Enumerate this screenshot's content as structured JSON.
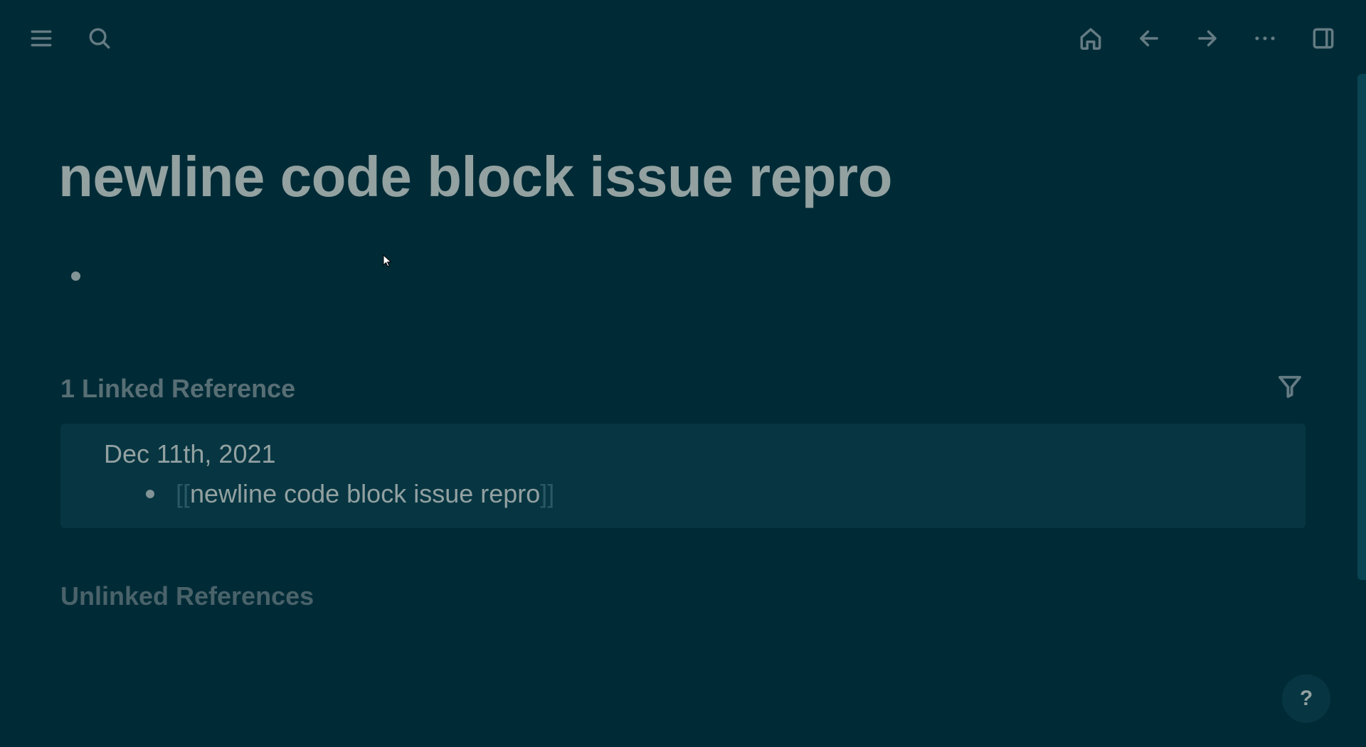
{
  "header": {
    "left_icons": [
      "menu-icon",
      "search-icon"
    ],
    "right_icons": [
      "home-icon",
      "arrow-left-icon",
      "arrow-right-icon",
      "more-icon",
      "sidebar-toggle-icon"
    ]
  },
  "page": {
    "title": "newline code block issue repro"
  },
  "linked_references": {
    "heading": "1 Linked Reference",
    "items": [
      {
        "date": "Dec 11th, 2021",
        "open_bracket": "[[",
        "ref_text": "newline code block issue repro",
        "close_bracket": "]]"
      }
    ]
  },
  "unlinked_references": {
    "heading": "Unlinked References"
  },
  "help": {
    "label": "?"
  },
  "colors": {
    "background": "#002b36",
    "card": "#073642",
    "text": "#93a1a1",
    "muted": "#586e75"
  }
}
